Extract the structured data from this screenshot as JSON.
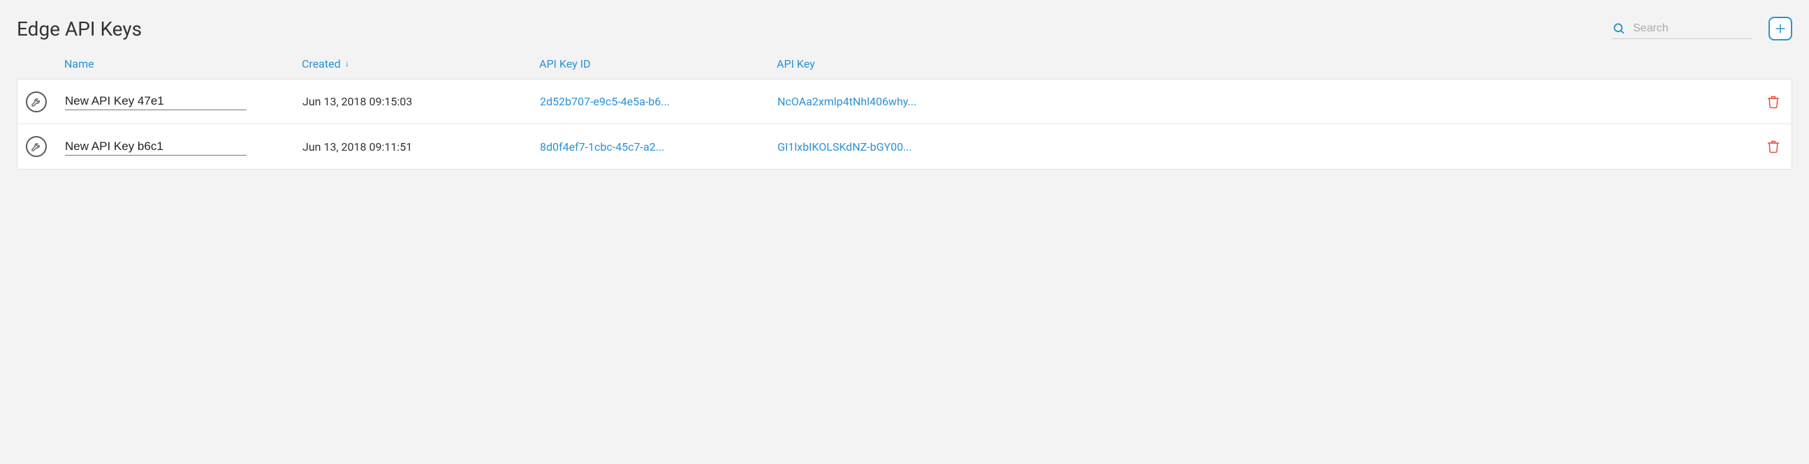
{
  "header": {
    "title": "Edge API Keys",
    "search_placeholder": "Search"
  },
  "colors": {
    "accent": "#2a92d6",
    "danger": "#e74c3c",
    "icon_gray": "#5a5a5a"
  },
  "table": {
    "columns": {
      "name": "Name",
      "created": "Created",
      "api_key_id": "API Key ID",
      "api_key": "API Key"
    },
    "sorted_by": "created",
    "sort_dir": "desc",
    "rows": [
      {
        "name": "New API Key 47e1",
        "created": "Jun 13, 2018 09:15:03",
        "api_key_id": "2d52b707-e9c5-4e5a-b6...",
        "api_key": "NcOAa2xmlp4tNhl406why..."
      },
      {
        "name": "New API Key b6c1",
        "created": "Jun 13, 2018 09:11:51",
        "api_key_id": "8d0f4ef7-1cbc-45c7-a2...",
        "api_key": "GI1lxbIKOLSKdNZ-bGY00..."
      }
    ]
  }
}
